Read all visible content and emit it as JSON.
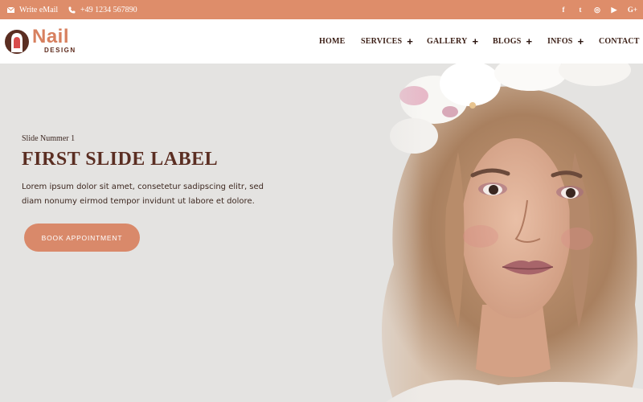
{
  "topbar": {
    "email_label": "Write eMail",
    "phone_label": "+49 1234 567890",
    "social": [
      {
        "icon": "facebook-icon",
        "glyph": "f"
      },
      {
        "icon": "twitter-icon",
        "glyph": "t"
      },
      {
        "icon": "instagram-icon",
        "glyph": "◎"
      },
      {
        "icon": "youtube-icon",
        "glyph": "▶"
      },
      {
        "icon": "google-plus-icon",
        "glyph": "G+"
      }
    ]
  },
  "logo": {
    "word": "Nail",
    "sub": "DESIGN"
  },
  "nav": {
    "items": [
      {
        "label": "HOME",
        "has_submenu": false
      },
      {
        "label": "SERVICES",
        "has_submenu": true
      },
      {
        "label": "GALLERY",
        "has_submenu": true
      },
      {
        "label": "BLOGS",
        "has_submenu": true
      },
      {
        "label": "INFOS",
        "has_submenu": true
      },
      {
        "label": "CONTACT",
        "has_submenu": false
      }
    ],
    "submenu_glyph": "+"
  },
  "hero": {
    "eyebrow": "Slide Nummer 1",
    "headline": "FIRST SLIDE LABEL",
    "lead": "Lorem ipsum dolor sit amet, consetetur sadipscing elitr, sed diam nonumy eirmod tempor invidunt ut labore et dolore.",
    "cta_label": "BOOK APPOINTMENT"
  },
  "colors": {
    "accent": "#de8d6a",
    "brand_dark": "#5b2e22",
    "hero_bg": "#e4e3e1",
    "header_bg": "#ffffff"
  }
}
